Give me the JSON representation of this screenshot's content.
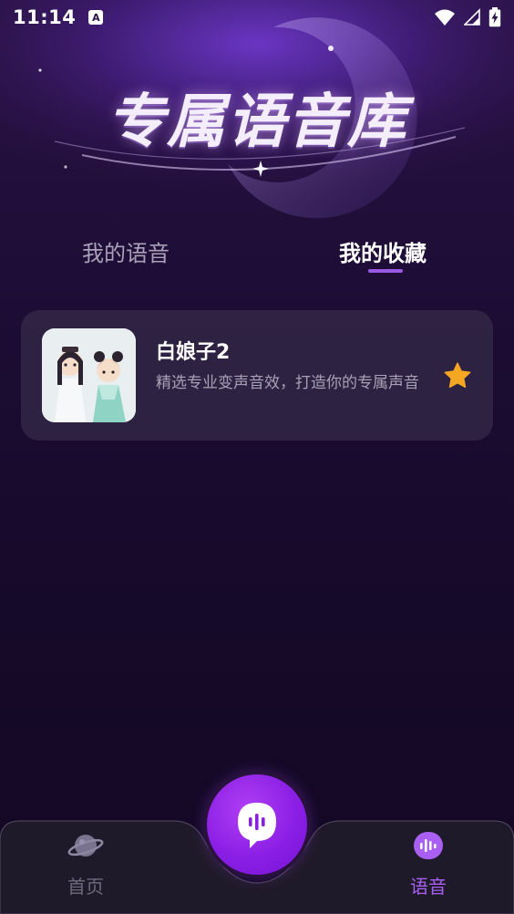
{
  "status_bar": {
    "time": "11:14",
    "app_icon_letter": "A"
  },
  "banner": {
    "title": "专属语音库"
  },
  "tabs": [
    {
      "label": "我的语音",
      "active": false
    },
    {
      "label": "我的收藏",
      "active": true
    }
  ],
  "favorites": [
    {
      "title": "白娘子2",
      "description": "精选专业变声音效，打造你的专属声音",
      "favorited": true
    }
  ],
  "bottom_nav": {
    "home_label": "首页",
    "voice_label": "语音",
    "active": "语音"
  },
  "colors": {
    "accent": "#9b59e6",
    "active_nav": "#a85ff2",
    "inactive_nav": "#6f6a7e",
    "star": "#f5a623",
    "center_button": "#8a1fe4"
  },
  "icons": {
    "status_wifi": "wifi-icon",
    "status_signal": "signal-icon",
    "status_battery": "battery-charging-icon",
    "star": "star-icon",
    "center": "speech-bubble-icon",
    "home": "planet-icon",
    "voice": "voice-wave-icon"
  }
}
